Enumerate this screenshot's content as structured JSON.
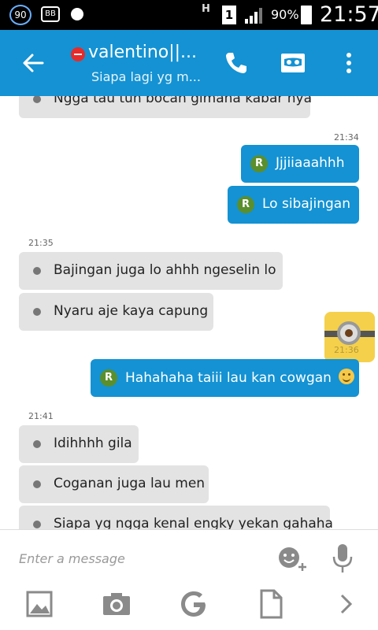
{
  "status_bar": {
    "notification_count": "90",
    "bbm_label": "BB",
    "network_type": "H",
    "sim_slot": "1",
    "battery_percent": "90%",
    "time": "21:57"
  },
  "header": {
    "contact_name": "valentino||...",
    "contact_status": "Siapa lagi yg m..."
  },
  "messages": [
    {
      "direction": "in",
      "text": "Ngga tau tuh bocah gimana kabar nya"
    },
    {
      "type": "timestamp",
      "text": "21:34"
    },
    {
      "direction": "out",
      "badge": "R",
      "text": "Jjjiiaaahhh"
    },
    {
      "direction": "out",
      "badge": "R",
      "text": "Lo sibajingan"
    },
    {
      "type": "timestamp",
      "text": "21:35"
    },
    {
      "direction": "in",
      "text": "Bajingan juga lo ahhh ngeselin lo"
    },
    {
      "direction": "in",
      "text": "Nyaru aje kaya capung"
    },
    {
      "type": "sticker",
      "timestamp": "21:36"
    },
    {
      "direction": "out",
      "badge": "R",
      "text": "Hahahaha taiii lau kan cowgan"
    },
    {
      "type": "timestamp",
      "text": "21:41"
    },
    {
      "direction": "in",
      "text": "Idihhhh gila"
    },
    {
      "direction": "in",
      "text": "Coganan juga lau men"
    },
    {
      "direction": "in",
      "text": "Siapa yg ngga kenal engky yekan gahaha"
    }
  ],
  "composer": {
    "placeholder": "Enter a message"
  },
  "colors": {
    "accent": "#1492d3",
    "incoming_bubble": "#e3e3e3",
    "badge_green": "#5b8f2d",
    "presence_busy": "#e62b2b"
  },
  "icons": [
    "back-arrow-icon",
    "phone-icon",
    "video-call-icon",
    "more-vert-icon",
    "emoji-add-icon",
    "mic-icon",
    "image-icon",
    "camera-icon",
    "google-icon",
    "file-icon",
    "chevron-right-icon"
  ]
}
